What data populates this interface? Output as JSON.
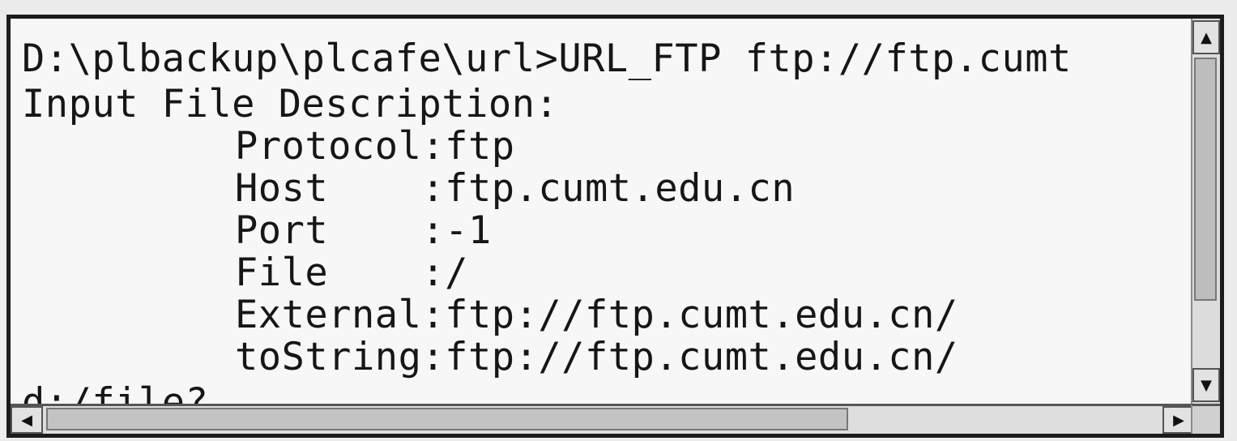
{
  "console": {
    "command_line": "D:\\plbackup\\plcafe\\url>URL_FTP ftp://ftp.cumt",
    "heading": "Input File Description:",
    "fields": [
      {
        "key": "Protocol",
        "value": "ftp"
      },
      {
        "key": "Host    ",
        "value": "ftp.cumt.edu.cn"
      },
      {
        "key": "Port    ",
        "value": "-1"
      },
      {
        "key": "File    ",
        "value": "/"
      },
      {
        "key": "External",
        "value": "ftp://ftp.cumt.edu.cn/"
      },
      {
        "key": "toString",
        "value": "ftp://ftp.cumt.edu.cn/"
      }
    ],
    "prompt_partial": "d:/file?"
  },
  "scrollbars": {
    "up_arrow": "▲",
    "down_arrow": "▼",
    "left_arrow": "◀",
    "right_arrow": "▶",
    "up_icon": "arrow-up-icon",
    "down_icon": "arrow-down-icon",
    "left_icon": "arrow-left-icon",
    "right_icon": "arrow-right-icon"
  }
}
